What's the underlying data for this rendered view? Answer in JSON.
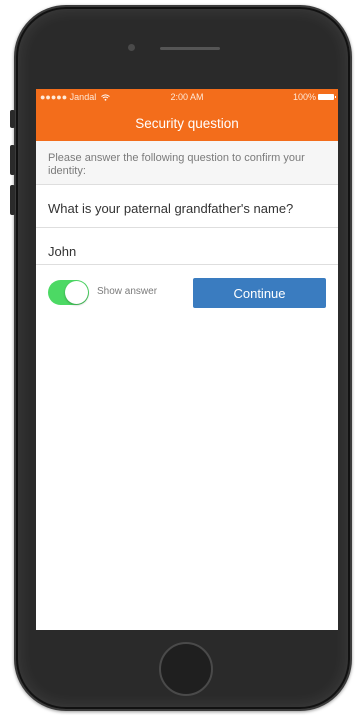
{
  "status_bar": {
    "carrier": "●●●●● Jandal",
    "wifi_icon": "wifi-icon",
    "time": "2:00 AM",
    "battery_percent": "100%",
    "battery_icon": "battery-icon"
  },
  "header": {
    "title": "Security question",
    "background": "#f36d1b"
  },
  "form": {
    "instructions": "Please answer the following question to confirm your identity:",
    "question": "What is your paternal grandfather's name?",
    "answer_value": "John",
    "show_answer_label": "Show answer",
    "show_answer_on": true,
    "continue_label": "Continue",
    "toggle_color": "#4cd964",
    "button_color": "#3a7cc0"
  }
}
